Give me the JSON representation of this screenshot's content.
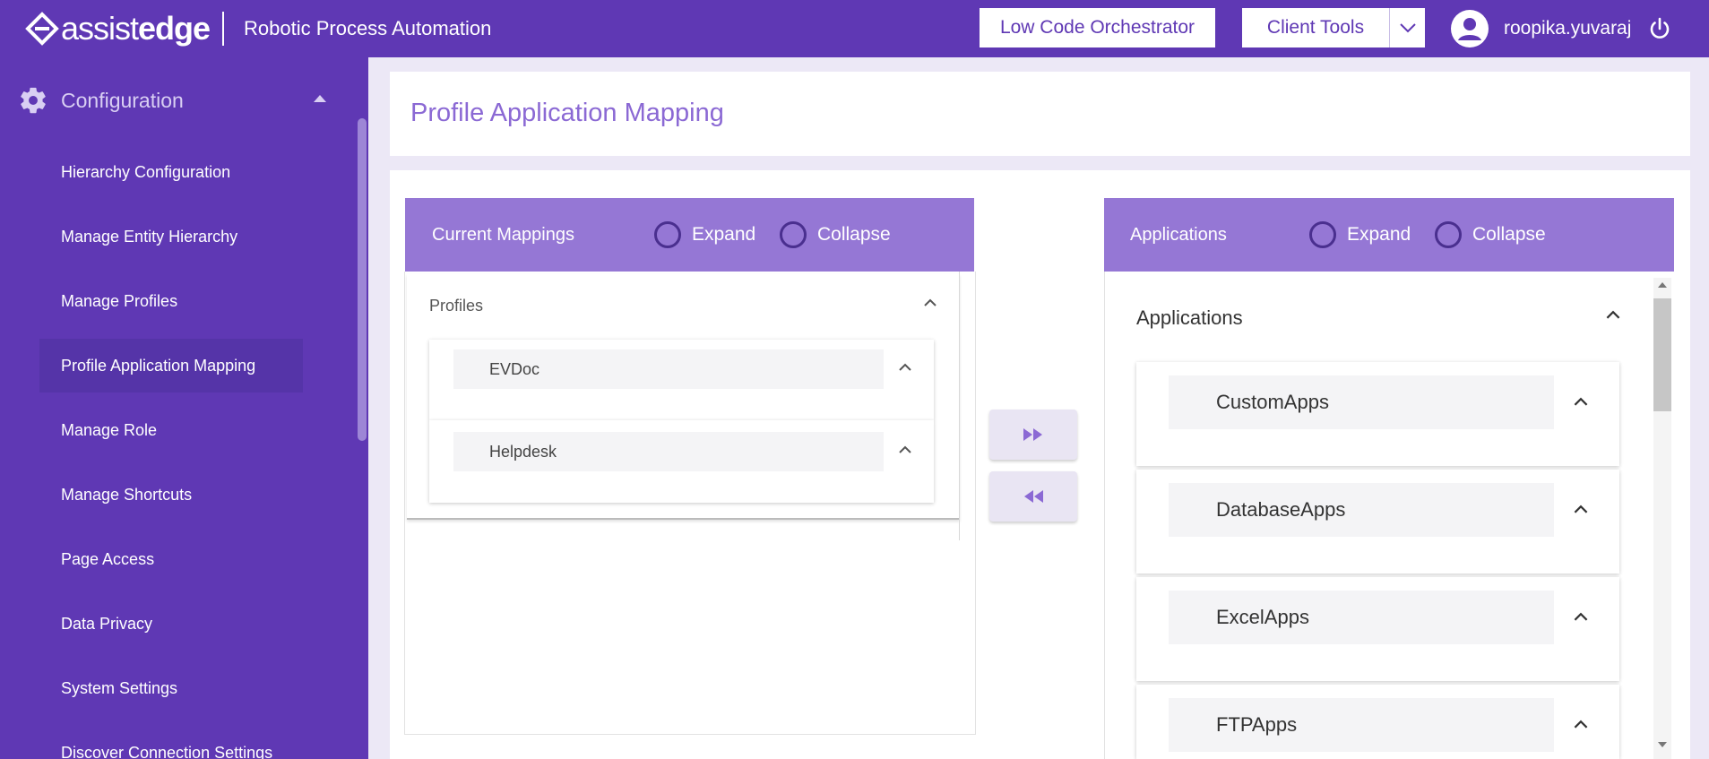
{
  "header": {
    "logo": {
      "prefix": "assist",
      "suffix": "edge"
    },
    "app_title": "Robotic Process Automation",
    "low_code_button": "Low Code Orchestrator",
    "client_tools_button": "Client Tools",
    "username": "roopika.yuvaraj"
  },
  "sidebar": {
    "section_label": "Configuration",
    "items": [
      {
        "label": "Hierarchy Configuration",
        "active": false
      },
      {
        "label": "Manage Entity Hierarchy",
        "active": false
      },
      {
        "label": "Manage Profiles",
        "active": false
      },
      {
        "label": "Profile Application Mapping",
        "active": true
      },
      {
        "label": "Manage Role",
        "active": false
      },
      {
        "label": "Manage Shortcuts",
        "active": false
      },
      {
        "label": "Page Access",
        "active": false
      },
      {
        "label": "Data Privacy",
        "active": false
      },
      {
        "label": "System Settings",
        "active": false
      },
      {
        "label": "Discover Connection Settings",
        "active": false
      }
    ]
  },
  "page": {
    "title": "Profile Application Mapping"
  },
  "left_panel": {
    "title": "Current Mappings",
    "expand_label": "Expand",
    "collapse_label": "Collapse",
    "group_label": "Profiles",
    "profiles": [
      "EVDoc",
      "Helpdesk"
    ]
  },
  "right_panel": {
    "title": "Applications",
    "expand_label": "Expand",
    "collapse_label": "Collapse",
    "group_label": "Applications",
    "apps": [
      "CustomApps",
      "DatabaseApps",
      "ExcelApps",
      "FTPApps"
    ]
  },
  "colors": {
    "primary": "#5f38b4",
    "panel_header": "#9577d5",
    "title_text": "#8b69d4"
  }
}
